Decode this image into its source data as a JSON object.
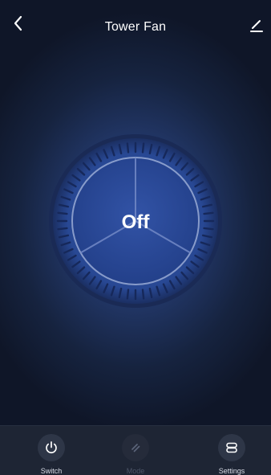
{
  "header": {
    "title": "Tower Fan"
  },
  "dial": {
    "status_text": "Off"
  },
  "bottom_bar": {
    "actions": [
      {
        "label": "Switch",
        "icon": "power-icon",
        "enabled": true
      },
      {
        "label": "Mode",
        "icon": "mode-icon",
        "enabled": false
      },
      {
        "label": "Settings",
        "icon": "settings-icon",
        "enabled": true
      }
    ]
  },
  "colors": {
    "background": "#16233f",
    "dial_blue": "#2a4ea8",
    "bottom_bar": "#1e2534",
    "text": "#ffffff"
  }
}
